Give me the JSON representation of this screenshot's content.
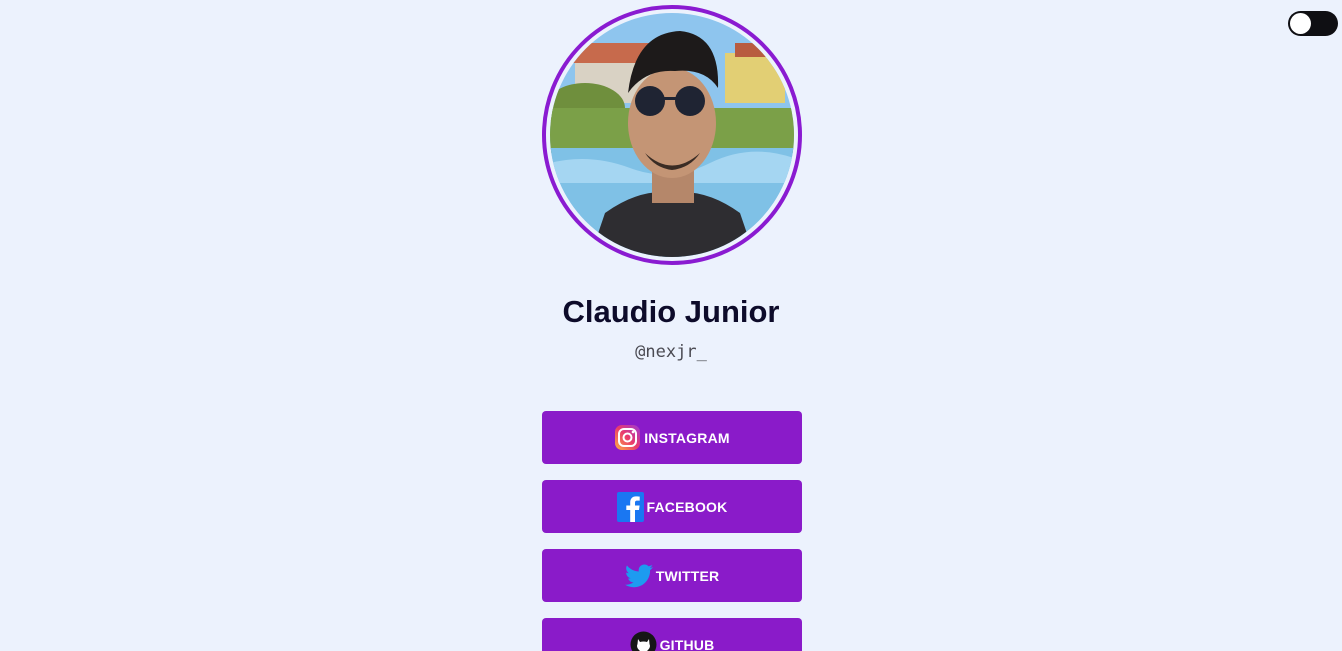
{
  "theme_toggle": {
    "state": "off"
  },
  "profile": {
    "name": "Claudio Junior",
    "handle": "@nexjr_"
  },
  "links": [
    {
      "label": "INSTAGRAM",
      "icon": "instagram-icon"
    },
    {
      "label": "FACEBOOK",
      "icon": "facebook-icon"
    },
    {
      "label": "TWITTER",
      "icon": "twitter-icon"
    },
    {
      "label": "GITHUB",
      "icon": "github-icon"
    }
  ],
  "colors": {
    "background": "#ecf2fd",
    "accent": "#8a1bc9",
    "name_text": "#0d0b2a"
  }
}
